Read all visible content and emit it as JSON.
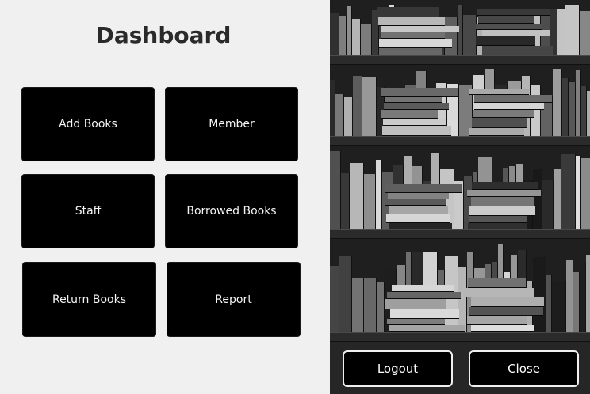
{
  "dashboard": {
    "title": "Dashboard",
    "tiles": [
      {
        "label": "Add Books"
      },
      {
        "label": "Member"
      },
      {
        "label": "Staff"
      },
      {
        "label": "Borrowed Books"
      },
      {
        "label": "Return Books"
      },
      {
        "label": "Report"
      }
    ]
  },
  "side_panel": {
    "image": "bookshelf-photo",
    "logout_label": "Logout",
    "close_label": "Close"
  },
  "colors": {
    "background": "#f0f0f0",
    "tile": "#000000",
    "tile_text": "#f5f5f5",
    "title": "#2a2a2a"
  }
}
